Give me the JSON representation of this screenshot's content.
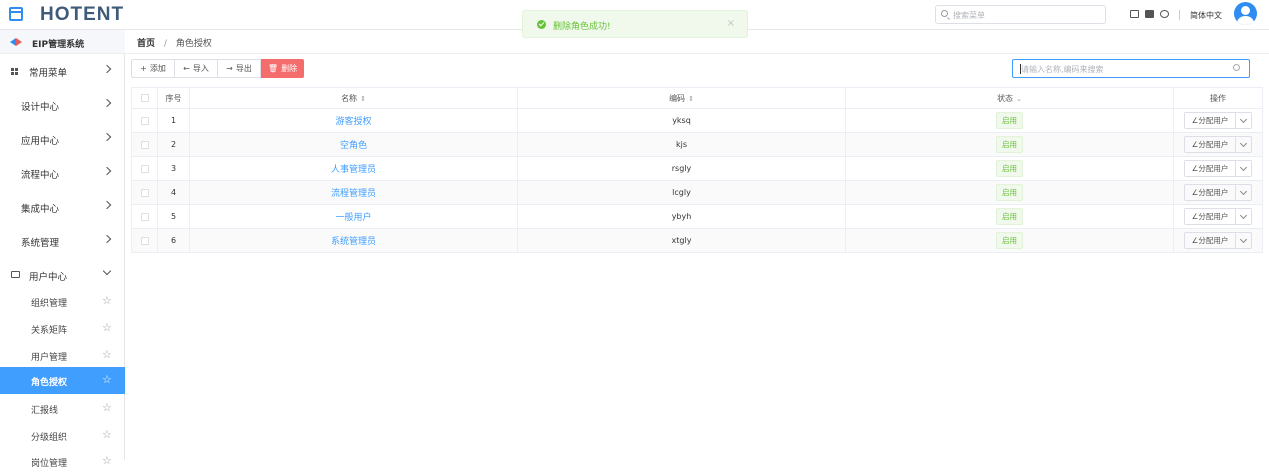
{
  "header": {
    "logo_text": "HOTENT",
    "search_placeholder": "搜索菜单",
    "language": "简体中文"
  },
  "toast": {
    "message": "删除角色成功!",
    "close": "×"
  },
  "sidebar": {
    "system_title": "EIP管理系统",
    "items": [
      {
        "label": "常用菜单"
      },
      {
        "label": "设计中心"
      },
      {
        "label": "应用中心"
      },
      {
        "label": "流程中心"
      },
      {
        "label": "集成中心"
      },
      {
        "label": "系统管理"
      },
      {
        "label": "用户中心"
      }
    ],
    "sub_items": [
      {
        "label": "组织管理"
      },
      {
        "label": "关系矩阵"
      },
      {
        "label": "用户管理"
      },
      {
        "label": "角色授权"
      },
      {
        "label": "汇报线"
      },
      {
        "label": "分级组织"
      },
      {
        "label": "岗位管理"
      }
    ]
  },
  "breadcrumb": {
    "home": "首页",
    "separator": "/",
    "current": "角色授权"
  },
  "toolbar": {
    "add": "添加",
    "import": "导入",
    "export": "导出",
    "delete": "删除",
    "search_placeholder": "请输入名称,编码来搜索"
  },
  "table": {
    "headers": {
      "index": "序号",
      "name": "名称",
      "code": "编码",
      "status": "状态",
      "actions": "操作"
    },
    "rows": [
      {
        "index": "1",
        "name": "游客授权",
        "code": "yksq",
        "status": "启用",
        "action": "分配用户"
      },
      {
        "index": "2",
        "name": "空角色",
        "code": "kjs",
        "status": "启用",
        "action": "分配用户"
      },
      {
        "index": "3",
        "name": "人事管理员",
        "code": "rsgly",
        "status": "启用",
        "action": "分配用户"
      },
      {
        "index": "4",
        "name": "流程管理员",
        "code": "lcgly",
        "status": "启用",
        "action": "分配用户"
      },
      {
        "index": "5",
        "name": "一般用户",
        "code": "ybyh",
        "status": "启用",
        "action": "分配用户"
      },
      {
        "index": "6",
        "name": "系统管理员",
        "code": "xtgly",
        "status": "启用",
        "action": "分配用户"
      }
    ]
  },
  "colors": {
    "accent": "#409eff",
    "danger": "#f56c6c",
    "success": "#67c23a"
  }
}
